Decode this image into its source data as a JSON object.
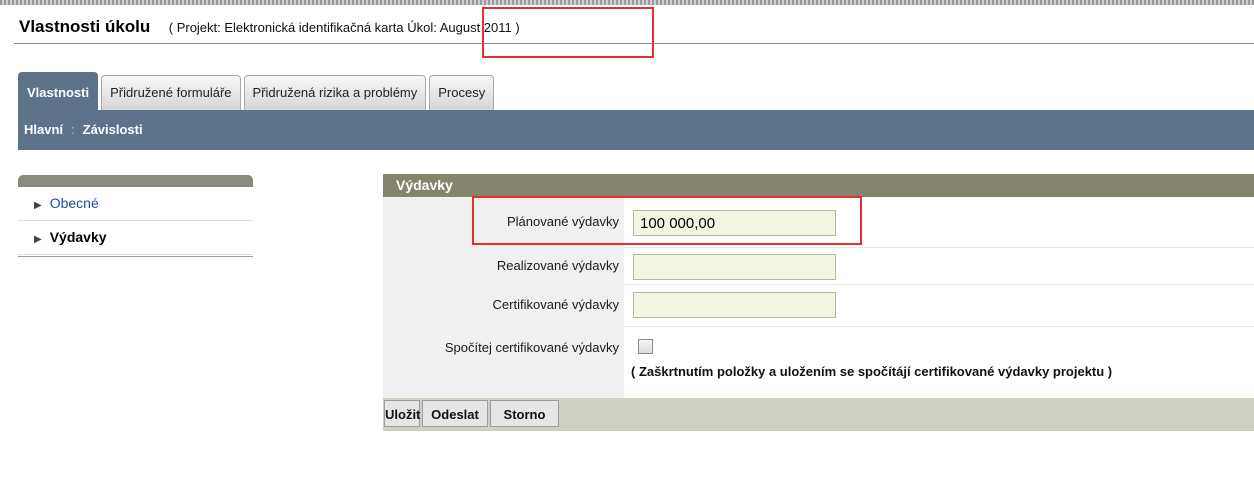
{
  "page": {
    "title": "Vlastnosti úkolu",
    "subtitle_project": "( Projekt: Elektronická identifikačná karta",
    "subtitle_task": "Úkol: August 2011 )"
  },
  "tabs": [
    {
      "label": "Vlastnosti",
      "active": true
    },
    {
      "label": "Přidružené formuláře",
      "active": false
    },
    {
      "label": "Přidružená rizika a problémy",
      "active": false
    },
    {
      "label": "Procesy",
      "active": false
    }
  ],
  "subnav": {
    "items": [
      "Hlavní",
      "Závislosti"
    ],
    "separator": ":"
  },
  "sidebar": {
    "items": [
      {
        "label": "Obecné",
        "active": false
      },
      {
        "label": "Výdavky",
        "active": true
      }
    ]
  },
  "form": {
    "header": "Výdavky",
    "fields": {
      "planned": {
        "label": "Plánované výdavky",
        "value": "100 000,00"
      },
      "realized": {
        "label": "Realizované výdavky",
        "value": ""
      },
      "certified": {
        "label": "Certifikované výdavky",
        "value": ""
      },
      "compute": {
        "label": "Spočítej certifikované výdavky",
        "checked": false,
        "hint": "( Zaškrtnutím položky a uložením se spočítájí certifikované výdavky projektu )"
      }
    },
    "buttons": {
      "save": "Uložit",
      "send": "Odeslat",
      "cancel": "Storno"
    }
  },
  "colors": {
    "accent": "#5e7389",
    "section_header": "#85856f",
    "annotation": "#e53030"
  }
}
